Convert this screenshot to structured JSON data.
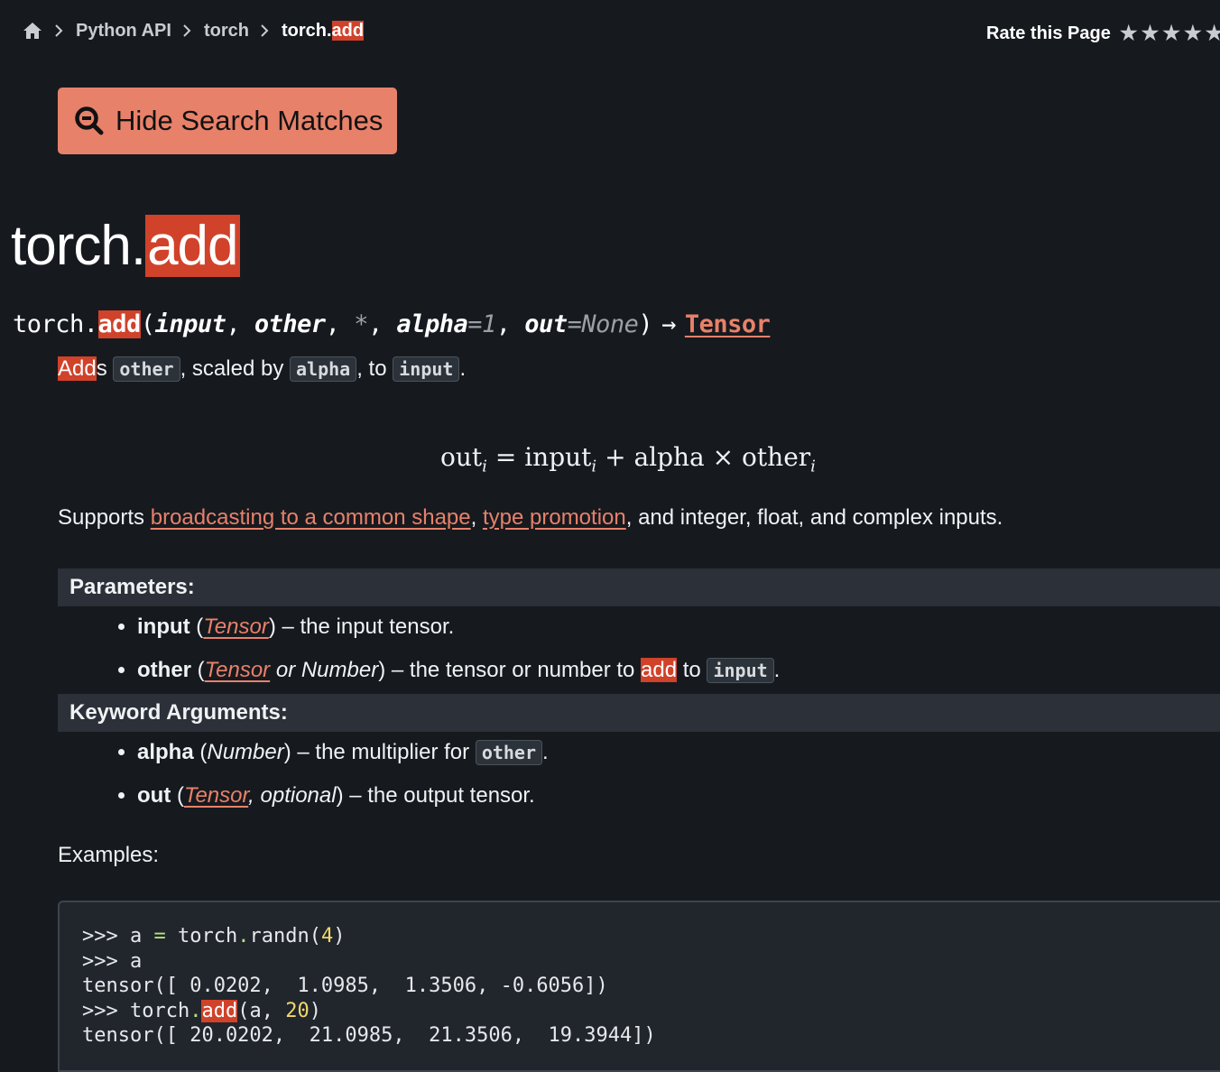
{
  "breadcrumb": {
    "home_icon": "home-icon",
    "items": [
      "Python API",
      "torch"
    ],
    "current_prefix": "torch.",
    "current_match": "add"
  },
  "rating": {
    "label": "Rate this Page",
    "stars": 5
  },
  "search_button": {
    "label": "Hide Search Matches",
    "icon": "search-minus-icon"
  },
  "title": {
    "prefix": "torch.",
    "match": "add"
  },
  "signature": {
    "prefix": "torch.",
    "name": "add",
    "open": "(",
    "p1": "input",
    "p2": "other",
    "star": "*",
    "p3": "alpha",
    "p3_default": "=1",
    "p4": "out",
    "p4_default": "=None",
    "close": ")",
    "arrow": "→",
    "return_type": "Tensor"
  },
  "description": {
    "match": "Add",
    "s": "s",
    "code1": "other",
    "mid": ", scaled by",
    "code2": "alpha",
    "to": ", to",
    "code3": "input",
    "end": "."
  },
  "formula": {
    "out": "out",
    "eq": "=",
    "input": "input",
    "plus": "+",
    "alpha": "alpha",
    "times": "×",
    "other": "other",
    "sub": "i"
  },
  "supports": {
    "pre": "Supports ",
    "link1": "broadcasting to a common shape",
    "comma": ", ",
    "link2": "type promotion",
    "post": ", and integer, float, and complex inputs."
  },
  "parameters": {
    "heading": "Parameters:",
    "items": [
      {
        "name": "input",
        "open": " (",
        "type": "Tensor",
        "close": ")",
        "desc": " – the input tensor."
      },
      {
        "name": "other",
        "open": " (",
        "type": "Tensor",
        "type_extra": " or Number",
        "close": ")",
        "desc": " – the tensor or number to ",
        "match": "add",
        "desc2": " to ",
        "code": "input",
        "end": "."
      }
    ]
  },
  "keyword_arguments": {
    "heading": "Keyword Arguments:",
    "items": [
      {
        "name": "alpha",
        "open": " (",
        "type": "Number",
        "close": ")",
        "desc": " – the multiplier for ",
        "code": "other",
        "end": "."
      },
      {
        "name": "out",
        "open": " (",
        "type": "Tensor",
        "type_extra": ", optional",
        "close": ")",
        "desc": " – the output tensor."
      }
    ]
  },
  "examples_label": "Examples:",
  "code": {
    "l1_prompt": ">>> ",
    "l1_a": "a ",
    "l1_eq": "=",
    "l1_b": " torch",
    "l1_dot": ".",
    "l1_c": "randn(",
    "l1_num": "4",
    "l1_d": ")",
    "l2": ">>> a",
    "l3": "tensor([ 0.0202,  1.0985,  1.3506, -0.6056])",
    "l4_prompt": ">>> torch",
    "l4_dot": ".",
    "l4_match": "add",
    "l4_a": "(a, ",
    "l4_num": "20",
    "l4_b": ")",
    "l5": "tensor([ 20.0202,  21.0985,  21.3506,  19.3944])"
  }
}
